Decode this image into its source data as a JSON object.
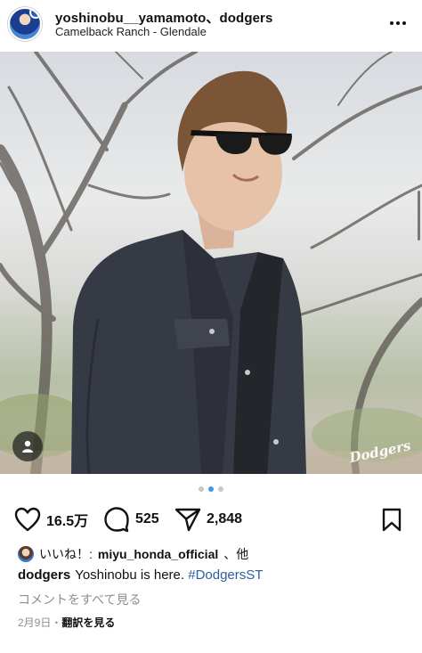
{
  "post": {
    "username": "yoshinobu__yamamoto、dodgers",
    "location": "Camelback Ranch - Glendale"
  },
  "carousel": {
    "total": 3,
    "active_index": 1
  },
  "photo": {
    "watermark": "Dodgers"
  },
  "actions": {
    "likes": "16.5万",
    "comments": "525",
    "shares": "2,848"
  },
  "liked_by": {
    "prefix": "いいね！:",
    "user": "miyu_honda_official",
    "suffix": "、他"
  },
  "caption": {
    "user": "dodgers",
    "text": "Yoshinobu is here.",
    "hashtag": "#DodgersST"
  },
  "view_comments": "コメントをすべて見る",
  "meta": {
    "date": "2月9日",
    "separator": "・",
    "translate": "翻訳を見る"
  },
  "colors": {
    "active_dot": "#3897f0",
    "hashtag": "#2b5fa0",
    "muted": "#8e8e8e"
  }
}
